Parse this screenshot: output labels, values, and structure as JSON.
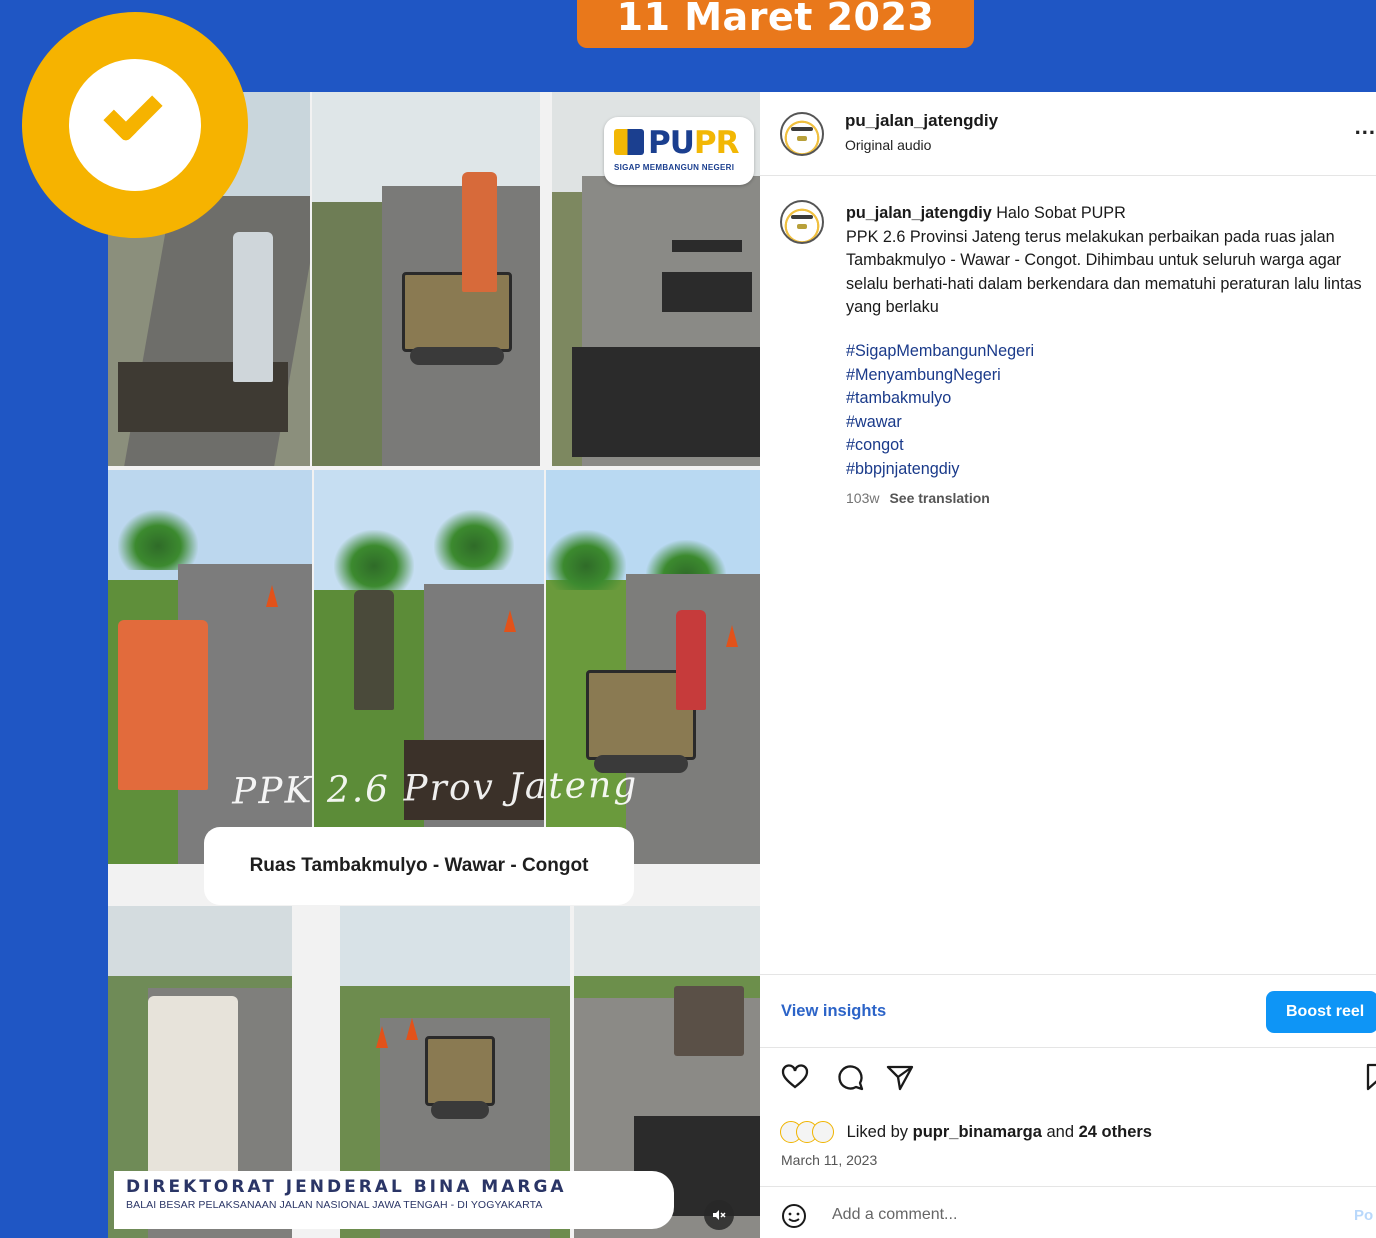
{
  "banner": {
    "date": "11 Maret 2023"
  },
  "media": {
    "logo_text_left": "PU",
    "logo_text_right": "PR",
    "logo_tagline": "SIGAP MEMBANGUN NEGERI",
    "script_caption": "PPK 2.6 Prov Jateng",
    "road_label": "Ruas Tambakmulyo - Wawar - Congot",
    "footer_title": "DIREKTORAT JENDERAL BINA MARGA",
    "footer_subtitle": "BALAI BESAR PELAKSANAAN JALAN NASIONAL JAWA TENGAH - DI YOGYAKARTA",
    "mute_icon": "speaker-muted-icon"
  },
  "post": {
    "username": "pu_jalan_jatengdiy",
    "audio": "Original audio",
    "more": "...",
    "caption_user": "pu_jalan_jatengdiy",
    "caption_text": " Halo Sobat PUPR\nPPK 2.6 Provinsi Jateng terus melakukan perbaikan pada ruas jalan Tambakmulyo - Wawar - Congot. Dihimbau untuk seluruh warga agar selalu berhati-hati dalam berkendara dan mematuhi peraturan lalu lintas yang berlaku",
    "hashtags": [
      "#SigapMembangunNegeri",
      "#MenyambungNegeri",
      "#tambakmulyo",
      "#wawar",
      "#congot",
      "#bbpjnjatengdiy"
    ],
    "age": "103w",
    "see_translation": "See translation",
    "view_insights": "View insights",
    "boost_label": "Boost reel",
    "liked_prefix": "Liked by ",
    "liked_user": "pupr_binamarga",
    "liked_and": " and ",
    "liked_others": "24 others",
    "date": "March 11, 2023",
    "comment_placeholder": "Add a comment...",
    "post_label": "Po"
  },
  "colors": {
    "background": "#1f56c4",
    "banner": "#e9781b",
    "badge": "#f6b300",
    "boost": "#0e95f6",
    "link": "#2c64c8"
  }
}
